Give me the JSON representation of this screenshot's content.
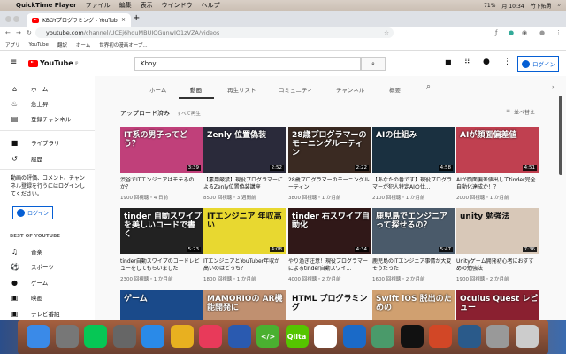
{
  "menubar": {
    "app": "QuickTime Player",
    "items": [
      "ファイル",
      "編集",
      "表示",
      "ウインドウ",
      "ヘルプ"
    ],
    "battery": "71%",
    "time": "月 10:34",
    "user": "竹下拓勇"
  },
  "browser": {
    "tab_title": "KBOYプログラミング - YouTube",
    "url_host": "youtube.com",
    "url_path": "/channel/UCEj6hquMBUIQGunwIO1zVZA/videos",
    "bookmarks": [
      "アプリ",
      "YouTube",
      "翻訳",
      "ホーム",
      "世界初の漫画オープ..."
    ]
  },
  "youtube": {
    "logo": "YouTube",
    "logo_region": "JP",
    "search_value": "Kboy",
    "login": "ログイン"
  },
  "sidebar": {
    "items": [
      "ホーム",
      "急上昇",
      "登録チャンネル"
    ],
    "library": [
      "ライブラリ",
      "履歴"
    ],
    "prompt": "動画の評価、コメント、チャンネル登録を行うにはログインしてください。",
    "login": "ログイン",
    "best_heading": "BEST OF YOUTUBE",
    "best": [
      "音楽",
      "スポーツ",
      "ゲーム",
      "映画",
      "テレビ番組"
    ]
  },
  "channel_tabs": [
    "ホーム",
    "動画",
    "再生リスト",
    "コミュニティ",
    "チャンネル",
    "概要"
  ],
  "section": {
    "title": "アップロード済み",
    "play_all": "すべて再生",
    "sort": "並べ替え"
  },
  "videos": [
    {
      "title": "渋谷でITエンジニアはモテるのか？",
      "meta": "1900 回視聴・4 日前",
      "dur": "3:39",
      "thumb": "IT系の男子ってどう？",
      "c": "#c0407a"
    },
    {
      "title": "【悪用厳禁】現役プログラマーによるZenly位置偽装講座",
      "meta": "8500 回視聴・3 週間前",
      "dur": "2:52",
      "thumb": "Zenly 位置偽装",
      "c": "#2a2a3a"
    },
    {
      "title": "28歳プログラマーのモーニングルーティン",
      "meta": "3800 回視聴・1 か月前",
      "dur": "2:22",
      "thumb": "28歳プログラマーのモーニングルーティン",
      "c": "#3a2a22"
    },
    {
      "title": "【あなたの番です】現役プログラマーが犯人特定AIの仕...",
      "meta": "2100 回視聴・1 か月前",
      "dur": "4:58",
      "thumb": "AIの仕組み",
      "c": "#1a3040"
    },
    {
      "title": "AIが顔面偏差値出してtinder完全自動化達成か！？",
      "meta": "2000 回視聴・1 か月前",
      "dur": "4:51",
      "thumb": "AIが顔面偏差値",
      "c": "#c04050"
    },
    {
      "title": "tinder自動スワイプのコードレビューをしてもらいました",
      "meta": "2300 回視聴・1 か月前",
      "dur": "5:23",
      "thumb": "tinder 自動スワイプを美しいコードで書く",
      "c": "#222"
    },
    {
      "title": "ITエンジニアとYouTuber年収が高いのはどっち？",
      "meta": "1800 回視聴・1 か月前",
      "dur": "4:08",
      "thumb": "ITエンジニア 年収高い",
      "c": "#e8d830"
    },
    {
      "title": "やり過ぎ注意！現役プログラマーによるtinder自動スワイ...",
      "meta": "4000 回視聴・2 か月前",
      "dur": "4:34",
      "thumb": "tinder 右スワイプ自動化",
      "c": "#301818"
    },
    {
      "title": "鹿児島のITエンジニア事情が大変そうだった",
      "meta": "1600 回視聴・2 か月前",
      "dur": "5:47",
      "thumb": "鹿児島でエンジニアって探せるの？",
      "c": "#4a5a6a"
    },
    {
      "title": "Unityゲーム開発初心者におすすめの勉強法",
      "meta": "1900 回視聴・2 か月前",
      "dur": "7:36",
      "thumb": "unity 勉強法",
      "c": "#d8c8b8"
    },
    {
      "title": "",
      "meta": "",
      "dur": "",
      "thumb": "ゲーム",
      "c": "#1a4a8a"
    },
    {
      "title": "",
      "meta": "",
      "dur": "",
      "thumb": "MAMORIOの AR機能開発に",
      "c": "#c09070"
    },
    {
      "title": "",
      "meta": "",
      "dur": "",
      "thumb": "HTML プログラミング",
      "c": "#f8f8f8"
    },
    {
      "title": "",
      "meta": "",
      "dur": "",
      "thumb": "Swift iOS 脱出のための",
      "c": "#d0a070"
    },
    {
      "title": "",
      "meta": "",
      "dur": "",
      "thumb": "Oculus Quest レビュー",
      "c": "#8a2030"
    }
  ],
  "dock": [
    {
      "n": "Finder",
      "c": "#3a8ae8"
    },
    {
      "n": "System Preferences",
      "c": "#777"
    },
    {
      "n": "LINE",
      "c": "#06c755"
    },
    {
      "n": "Launchpad",
      "c": "#666"
    },
    {
      "n": "Safari",
      "c": "#2a8ae8"
    },
    {
      "n": "Chrome",
      "c": "#e8b020"
    },
    {
      "n": "Music",
      "c": "#e83a5a"
    },
    {
      "n": "Thunderbird",
      "c": "#2a5ab0"
    },
    {
      "n": "</>",
      "c": "#4ab030"
    },
    {
      "n": "Qiita",
      "c": "#55c500"
    },
    {
      "n": "Slack",
      "c": "#fff"
    },
    {
      "n": "VS Code",
      "c": "#1a6ac8"
    },
    {
      "n": "Atom",
      "c": "#4a9a6a"
    },
    {
      "n": "Terminal",
      "c": "#111"
    },
    {
      "n": "PowerPoint",
      "c": "#d24726"
    },
    {
      "n": "QuickTime",
      "c": "#2a5a8a"
    },
    {
      "n": "Keychain",
      "c": "#999"
    },
    {
      "n": "Trash",
      "c": "#ccc"
    }
  ]
}
